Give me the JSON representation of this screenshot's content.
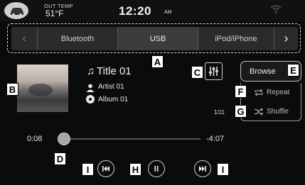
{
  "status_bar": {
    "out_temp_label": "OUT TEMP",
    "out_temp_value": "51°F",
    "time": "12:20",
    "ampm": "AM",
    "icons": [
      "car-icon",
      "wifi-icon"
    ]
  },
  "source_tabs": {
    "items": [
      {
        "label": "Bluetooth"
      },
      {
        "label": "USB"
      },
      {
        "label": "iPod/iPhone"
      }
    ],
    "prev_glyph": "‹",
    "next_glyph": "›"
  },
  "now_playing": {
    "title": "Title 01",
    "artist": "Artist 01",
    "album": "Album 01",
    "track_counter": "1/11",
    "note_glyph": "♫"
  },
  "controls": {
    "browse_label": "Browse",
    "repeat_label": "Repeat",
    "shuffle_label": "Shuffle"
  },
  "playback": {
    "elapsed": "0:08",
    "remaining": "-4:07",
    "progress": 0.03
  },
  "callouts": {
    "A": "A",
    "B": "B",
    "C": "C",
    "D": "D",
    "E": "E",
    "F": "F",
    "G": "G",
    "H": "H",
    "I": "I"
  },
  "colors": {
    "screen_bg": "#0b0b0b",
    "tab_bg": "#2b2b2b",
    "text": "#f0f0f0"
  }
}
